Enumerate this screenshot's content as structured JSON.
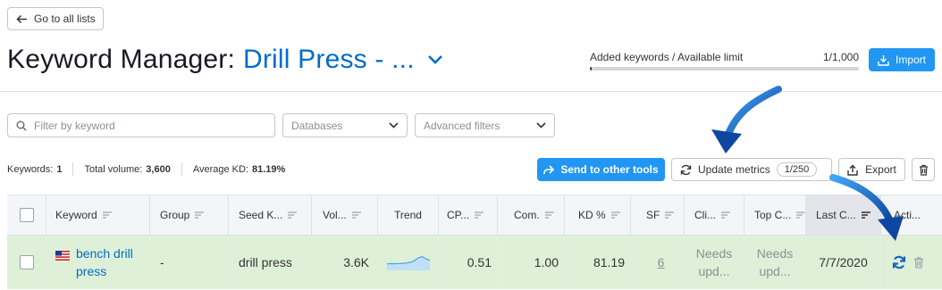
{
  "nav": {
    "back_label": "Go to all lists"
  },
  "header": {
    "title_prefix": "Keyword Manager:",
    "list_name": "Drill Press - ...",
    "limit_label": "Added keywords / Available limit",
    "limit_count": "1/1,000",
    "limit_progress": 0.001,
    "import_label": "Import"
  },
  "filters": {
    "keyword_placeholder": "Filter by keyword",
    "databases_label": "Databases",
    "advanced_label": "Advanced filters"
  },
  "stats": {
    "keywords_label": "Keywords:",
    "keywords_value": "1",
    "volume_label": "Total volume:",
    "volume_value": "3,600",
    "kd_label": "Average KD:",
    "kd_value": "81.19%"
  },
  "toolbar": {
    "send_label": "Send to other tools",
    "update_label": "Update metrics",
    "update_count": "1/250",
    "export_label": "Export"
  },
  "table": {
    "columns": [
      "Keyword",
      "Group",
      "Seed K...",
      "Vol...",
      "Trend",
      "CP...",
      "Com.",
      "KD %",
      "SF",
      "Cli...",
      "Top C...",
      "Last C...",
      "Acti..."
    ],
    "rows": [
      {
        "keyword": "bench drill press",
        "keyword_line1": "bench drill",
        "keyword_line2": "press",
        "group": "-",
        "seed": "drill press",
        "volume": "3.6K",
        "trend": [
          0.4,
          0.42,
          0.41,
          0.43,
          0.44,
          0.46,
          0.5,
          0.6,
          0.78,
          0.85,
          0.72,
          0.62
        ],
        "cpc": "0.51",
        "com": "1.00",
        "kd": "81.19",
        "sf": "6",
        "clicks_line1": "Needs",
        "clicks_line2": "upd...",
        "top_line1": "Needs",
        "top_line2": "upd...",
        "last_checked": "7/7/2020"
      }
    ]
  },
  "colors": {
    "accent": "#2196f3",
    "link": "#006dca",
    "row_highlight": "#dff0d8",
    "annotation_arrow": "#1565c0"
  }
}
